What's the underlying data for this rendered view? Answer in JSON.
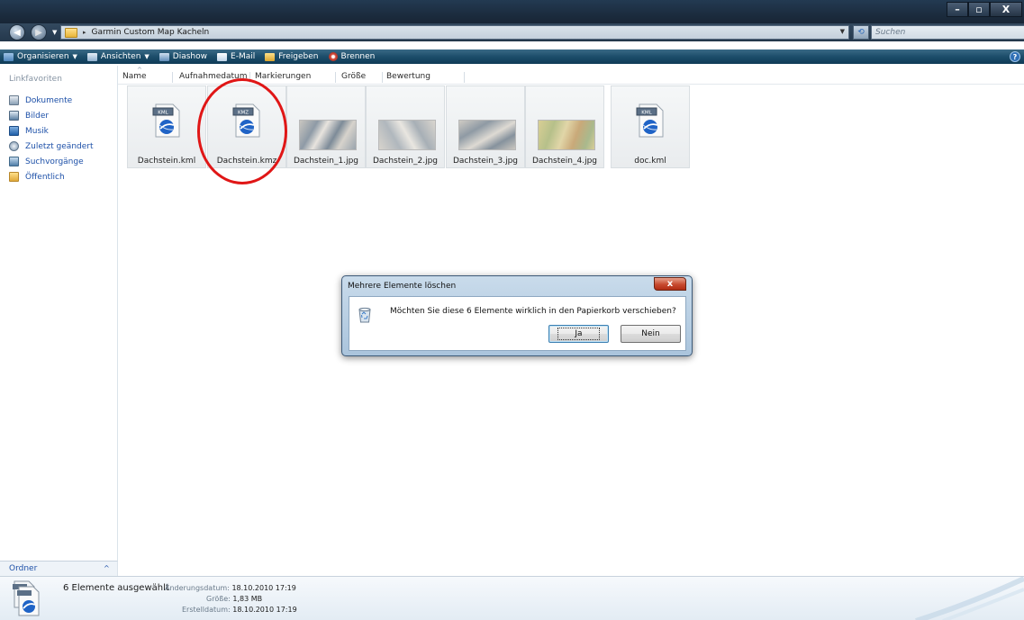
{
  "window": {
    "controls": {
      "minimize": "–",
      "maximize": "▫",
      "close": "X"
    }
  },
  "address": {
    "breadcrumb_arrow": "▸",
    "path": "Garmin Custom Map Kacheln",
    "search_placeholder": "Suchen"
  },
  "toolbar": {
    "items": [
      {
        "label": "Organisieren",
        "icon": "organize-icon",
        "dropdown": true
      },
      {
        "label": "Ansichten",
        "icon": "views-icon",
        "dropdown": true
      },
      {
        "label": "Diashow",
        "icon": "slideshow-icon",
        "dropdown": false
      },
      {
        "label": "E-Mail",
        "icon": "email-icon",
        "dropdown": false
      },
      {
        "label": "Freigeben",
        "icon": "share-icon",
        "dropdown": false
      },
      {
        "label": "Brennen",
        "icon": "burn-icon",
        "dropdown": false
      }
    ],
    "help": "?"
  },
  "sidebar": {
    "heading": "Linkfavoriten",
    "items": [
      {
        "label": "Dokumente",
        "icon": "documents-icon"
      },
      {
        "label": "Bilder",
        "icon": "pictures-icon"
      },
      {
        "label": "Musik",
        "icon": "music-icon"
      },
      {
        "label": "Zuletzt geändert",
        "icon": "recent-icon"
      },
      {
        "label": "Suchvorgänge",
        "icon": "searches-icon"
      },
      {
        "label": "Öffentlich",
        "icon": "public-folder-icon"
      }
    ],
    "folders_label": "Ordner",
    "folders_caret": "^"
  },
  "columns": [
    "Name",
    "Aufnahmedatum",
    "Markierungen",
    "Größe",
    "Bewertung"
  ],
  "files": [
    {
      "name": "Dachstein.kml",
      "type": "kml",
      "badge": "KML"
    },
    {
      "name": "Dachstein.kmz",
      "type": "kmz",
      "badge": "KMZ"
    },
    {
      "name": "Dachstein_1.jpg",
      "type": "jpg"
    },
    {
      "name": "Dachstein_2.jpg",
      "type": "jpg"
    },
    {
      "name": "Dachstein_3.jpg",
      "type": "jpg"
    },
    {
      "name": "Dachstein_4.jpg",
      "type": "jpg"
    },
    {
      "name": "doc.kml",
      "type": "kml",
      "badge": "KML"
    }
  ],
  "dialog": {
    "title": "Mehrere Elemente löschen",
    "close": "x",
    "message": "Möchten Sie diese 6 Elemente wirklich in den Papierkorb verschieben?",
    "yes": "Ja",
    "no": "Nein"
  },
  "status": {
    "count": "6 Elemente ausgewählt",
    "modified_label": "Änderungsdatum:",
    "modified_value": "18.10.2010 17:19",
    "size_label": "Größe:",
    "size_value": "1,83 MB",
    "created_label": "Erstelldatum:",
    "created_value": "18.10.2010 17:19"
  },
  "colors": {
    "accent_link": "#1d50a8",
    "annotation": "#e01616",
    "toolbar": "#1c4d6a"
  }
}
